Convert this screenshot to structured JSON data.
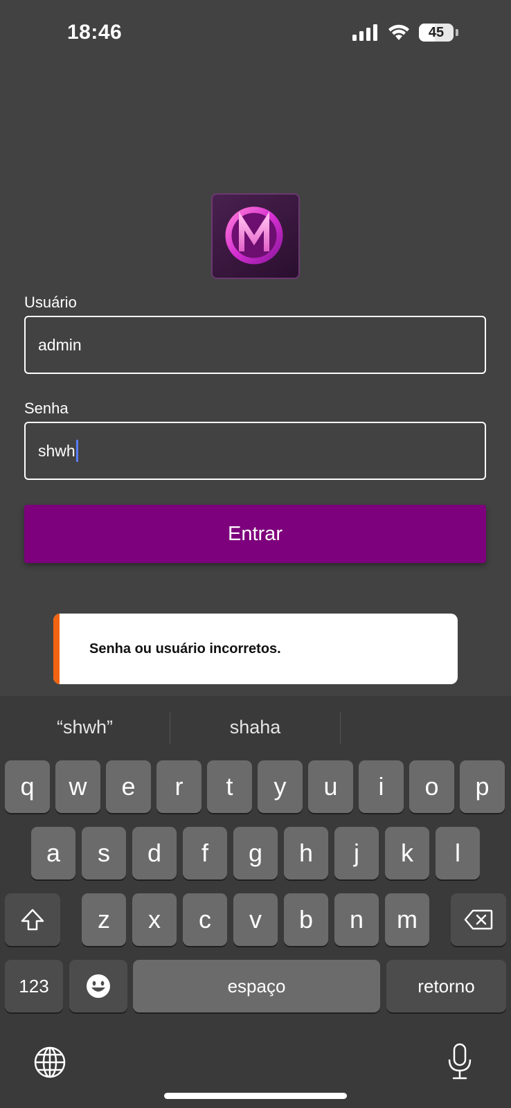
{
  "status_bar": {
    "time": "18:46",
    "battery": "45",
    "battery_level": 0.45
  },
  "app": {
    "logo_icon": "m-letter-logo",
    "username_label": "Usuário",
    "username_value": "admin",
    "password_label": "Senha",
    "password_value": "shwh",
    "login_button": "Entrar",
    "accent_color": "#7d007d"
  },
  "toast": {
    "message": "Senha ou usuário incorretos.",
    "accent_color": "#f26411"
  },
  "keyboard": {
    "suggestions": [
      "“shwh”",
      "shaha",
      ""
    ],
    "row1": [
      "q",
      "w",
      "e",
      "r",
      "t",
      "y",
      "u",
      "i",
      "o",
      "p"
    ],
    "row2": [
      "a",
      "s",
      "d",
      "f",
      "g",
      "h",
      "j",
      "k",
      "l"
    ],
    "row3": [
      "z",
      "x",
      "c",
      "v",
      "b",
      "n",
      "m"
    ],
    "numbers_key": "123",
    "space_key": "espaço",
    "return_key": "retorno"
  }
}
